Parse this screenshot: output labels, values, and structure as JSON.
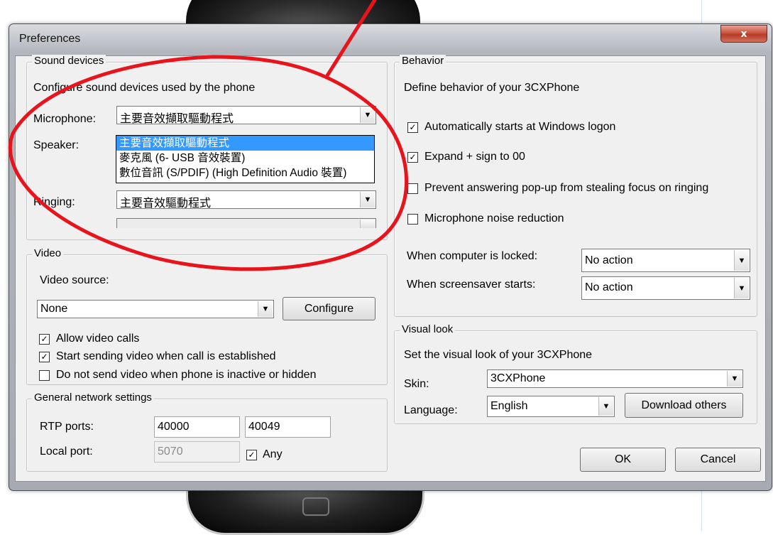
{
  "window": {
    "title": "Preferences",
    "close_label": "x"
  },
  "sound_devices": {
    "legend": "Sound devices",
    "description": "Configure sound devices used by the phone",
    "microphone_label": "Microphone:",
    "microphone_value": "主要音效擷取驅動程式",
    "speaker_label": "Speaker:",
    "ringing_label": "Ringing:",
    "ringing_value": "主要音效驅動程式",
    "dropdown_options": [
      "主要音效擷取驅動程式",
      "麥克風 (6- USB 音效裝置)",
      "數位音訊 (S/PDIF) (High Definition Audio 裝置)"
    ]
  },
  "video": {
    "legend": "Video",
    "source_label": "Video source:",
    "source_value": "None",
    "configure_button": "Configure",
    "allow_calls": "Allow video calls",
    "start_sending": "Start sending video when call is established",
    "do_not_send": "Do not send video when phone is inactive or hidden"
  },
  "network": {
    "legend": "General network settings",
    "rtp_label": "RTP ports:",
    "rtp_from": "40000",
    "rtp_to": "40049",
    "local_label": "Local port:",
    "local_value": "5070",
    "any_label": "Any"
  },
  "behavior": {
    "legend": "Behavior",
    "description": "Define behavior of your 3CXPhone",
    "auto_start": "Automatically starts at Windows logon",
    "expand_plus": "Expand + sign to 00",
    "prevent_popup": "Prevent answering pop-up from stealing focus on ringing",
    "noise_reduction": "Microphone noise reduction",
    "locked_label": "When computer is locked:",
    "locked_value": "No action",
    "screensaver_label": "When screensaver starts:",
    "screensaver_value": "No action"
  },
  "visual": {
    "legend": "Visual look",
    "description": "Set the visual look of your 3CXPhone",
    "skin_label": "Skin:",
    "skin_value": "3CXPhone",
    "language_label": "Language:",
    "language_value": "English",
    "download_button": "Download others"
  },
  "footer": {
    "ok_button": "OK",
    "cancel_button": "Cancel"
  },
  "checkbox_states": {
    "auto_start": true,
    "expand_plus": true,
    "prevent_popup": false,
    "noise_reduction": false,
    "allow_calls": true,
    "start_sending": true,
    "do_not_send": false,
    "any": true
  },
  "colors": {
    "annotation_red": "#e8141c",
    "selection_blue": "#3399ff",
    "close_red": "#c9543f"
  }
}
